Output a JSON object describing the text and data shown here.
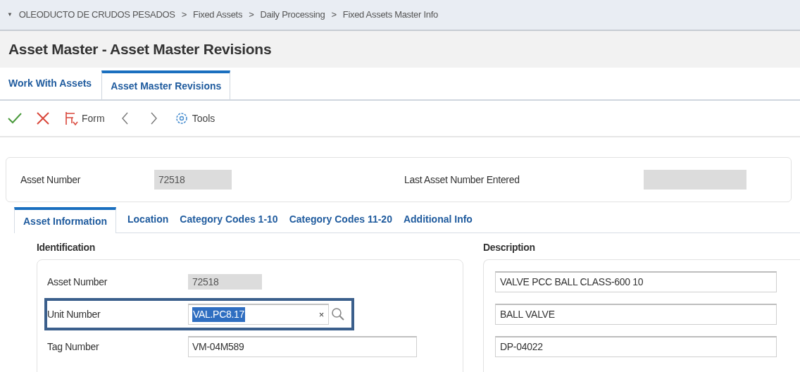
{
  "breadcrumb": {
    "toggle": "▼",
    "separator": ">",
    "items": [
      "OLEODUCTO DE CRUDOS PESADOS",
      "Fixed Assets",
      "Daily Processing",
      "Fixed Assets Master Info"
    ]
  },
  "title": "Asset Master - Asset Master Revisions",
  "form_tabs": [
    {
      "label": "Work With Assets",
      "selected": false
    },
    {
      "label": "Asset Master Revisions",
      "selected": true
    }
  ],
  "toolbar": [
    {
      "kind": "ok"
    },
    {
      "kind": "cancel"
    },
    {
      "kind": "form",
      "label": "Form"
    },
    {
      "kind": "prev"
    },
    {
      "kind": "next"
    },
    {
      "kind": "tools",
      "label": "Tools"
    }
  ],
  "header": {
    "asset_number": {
      "label": "Asset Number",
      "value": "72518"
    },
    "last_entered": {
      "label": "Last Asset Number Entered"
    }
  },
  "tabs": [
    {
      "label": "Asset Information",
      "selected": true
    },
    {
      "label": "Location",
      "selected": false
    },
    {
      "label": "Category Codes 1-10",
      "selected": false
    },
    {
      "label": "Category Codes 11-20",
      "selected": false
    },
    {
      "label": "Additional Info",
      "selected": false
    }
  ],
  "identification": {
    "title": "Identification",
    "fields": [
      {
        "label": "Asset Number",
        "value": "72518",
        "kind": "readonly",
        "highlighted": false,
        "text_selected": false
      },
      {
        "label": "Unit Number",
        "value": "VAL.PC8.17",
        "kind": "lookup",
        "clear": "×",
        "highlighted": true,
        "text_selected": true
      },
      {
        "label": "Tag Number",
        "value": "VM-04M589",
        "kind": "text",
        "highlighted": false,
        "text_selected": false
      }
    ]
  },
  "description": {
    "title": "Description",
    "lines": [
      "VALVE PCC BALL CLASS-600 10",
      "BALL VALVE",
      "DP-04022"
    ]
  }
}
